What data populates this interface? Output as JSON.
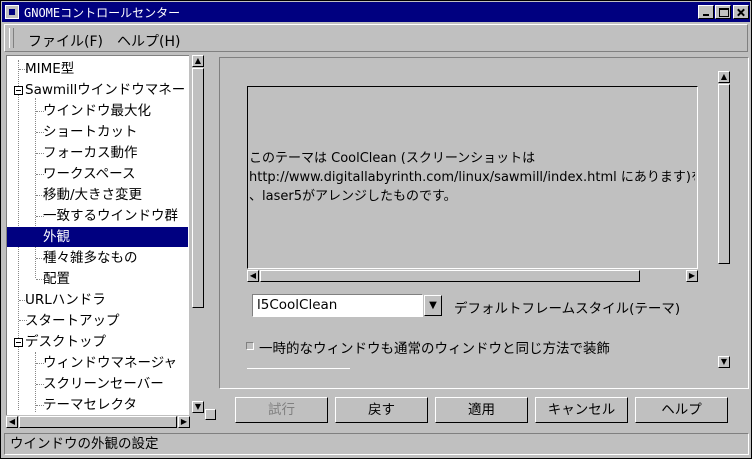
{
  "window": {
    "title": "GNOMEコントロールセンター"
  },
  "menu": {
    "file": "ファイル(F)",
    "help": "ヘルプ(H)"
  },
  "tree": {
    "items": [
      {
        "label": "MIME型",
        "level": 0
      },
      {
        "label": "Sawmillウインドウマネー",
        "level": 0,
        "expanded": true
      },
      {
        "label": "ウインドウ最大化",
        "level": 1
      },
      {
        "label": "ショートカット",
        "level": 1
      },
      {
        "label": "フォーカス動作",
        "level": 1
      },
      {
        "label": "ワークスペース",
        "level": 1
      },
      {
        "label": "移動/大きさ変更",
        "level": 1
      },
      {
        "label": "一致するウインドウ群",
        "level": 1
      },
      {
        "label": "外観",
        "level": 1,
        "selected": true
      },
      {
        "label": "種々雑多なもの",
        "level": 1
      },
      {
        "label": "配置",
        "level": 1
      },
      {
        "label": "URLハンドラ",
        "level": 0
      },
      {
        "label": "スタートアップ",
        "level": 0
      },
      {
        "label": "デスクトップ",
        "level": 0,
        "expanded": true
      },
      {
        "label": "ウィンドウマネージャ",
        "level": 1
      },
      {
        "label": "スクリーンセーバー",
        "level": 1
      },
      {
        "label": "テーマセレクタ",
        "level": 1
      }
    ]
  },
  "theme": {
    "description_lines": [
      "このテーマは CoolClean (スクリーンショットは",
      "http://www.digitallabyrinth.com/linux/sawmill/index.html にあります)をもと",
      "、laser5がアレンジしたものです。"
    ],
    "selected": "l5CoolClean",
    "label": "デフォルトフレームスタイル(テーマ)"
  },
  "option": {
    "transient_label": "一時的なウィンドウも通常のウィンドウと同じ方法で装飾",
    "transient_checked": false
  },
  "buttons": {
    "try": "試行",
    "revert": "戻す",
    "apply": "適用",
    "cancel": "キャンセル",
    "help": "ヘルプ"
  },
  "status": "ウインドウの外観の設定",
  "icons": {
    "app": "app-icon",
    "minimize": "minimize-icon",
    "maximize": "maximize-icon",
    "close": "close-icon",
    "dropdown": "triangle-down-icon"
  }
}
